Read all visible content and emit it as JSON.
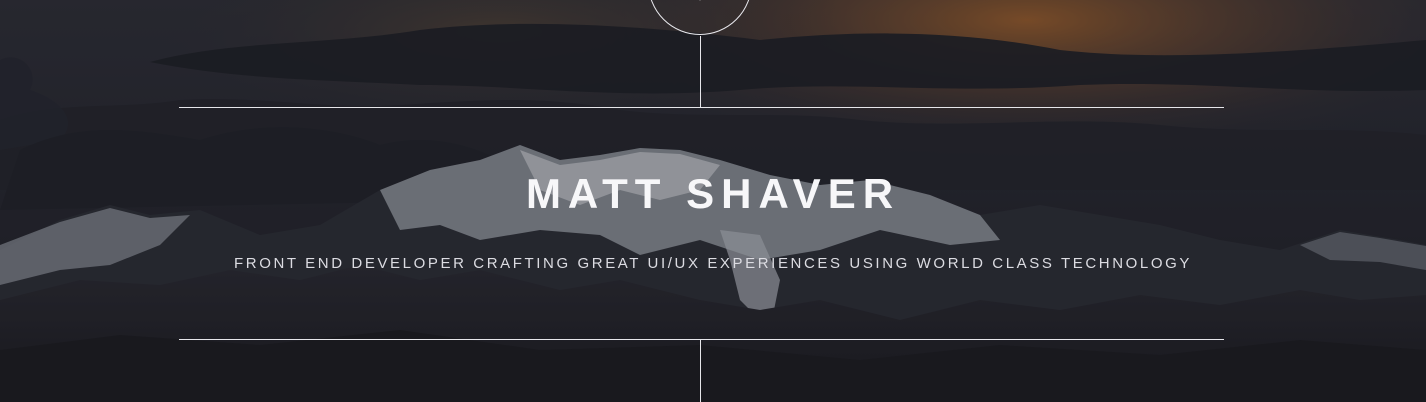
{
  "hero": {
    "name": "MATT SHAVER",
    "tagline": "FRONT END DEVELOPER CRAFTING GREAT UI/UX EXPERIENCES USING WORLD CLASS TECHNOLOGY",
    "scroll_icon": "chevron-down-icon"
  },
  "colors": {
    "sky_top": "#2a2b33",
    "sunset": "#c0702e",
    "cloud_dark": "#1e2028",
    "snow": "#c8ccd2",
    "rock": "#22222a",
    "line": "#e6e6ea",
    "text": "#ffffff"
  }
}
